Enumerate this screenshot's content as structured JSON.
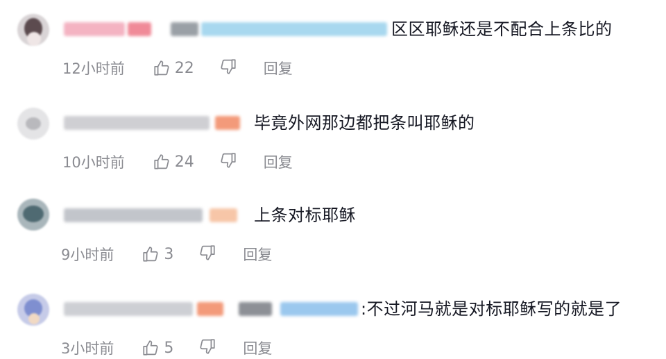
{
  "comments": [
    {
      "content": "区区耶稣还是不配合上条比的",
      "time": "12小时前",
      "likes": "22",
      "reply_label": "回复",
      "reply_to": true,
      "username_colors": [
        "#f4a6b8",
        "#f08a98",
        "#9aa0a6",
        "#a8d8ef",
        "#7cc2e8"
      ]
    },
    {
      "content": "毕竟外网那边都把条叫耶稣的",
      "time": "10小时前",
      "likes": "24",
      "reply_label": "回复",
      "reply_to": false,
      "username_colors": [
        "#c9c9cc",
        "#f39a7a"
      ]
    },
    {
      "content": "上条对标耶稣",
      "time": "9小时前",
      "likes": "3",
      "reply_label": "回复",
      "reply_to": false,
      "username_colors": [
        "#b8bbc2",
        "#f7c6a8"
      ]
    },
    {
      "content": ":不过河马就是对标耶稣写的就是了",
      "time": "3小时前",
      "likes": "5",
      "reply_label": "回复",
      "reply_to": true,
      "username_colors": [
        "#c9cbd0",
        "#f39a7a",
        "#8d9096",
        "#9bc8ee"
      ]
    }
  ],
  "colors": {
    "text_primary": "#161823",
    "text_secondary": "#8a8b91",
    "background": "#ffffff"
  },
  "icons": {
    "like": "thumbs-up-icon",
    "dislike": "thumbs-down-icon"
  }
}
